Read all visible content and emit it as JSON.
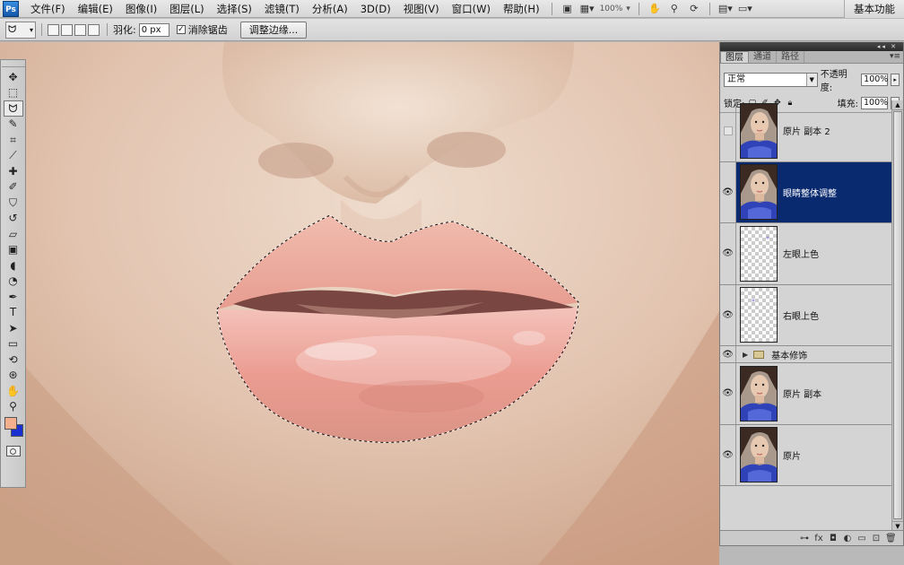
{
  "app": {
    "logo": "Ps"
  },
  "menu": [
    {
      "label": "文件(F)"
    },
    {
      "label": "编辑(E)"
    },
    {
      "label": "图像(I)"
    },
    {
      "label": "图层(L)"
    },
    {
      "label": "选择(S)"
    },
    {
      "label": "滤镜(T)"
    },
    {
      "label": "分析(A)"
    },
    {
      "label": "3D(D)"
    },
    {
      "label": "视图(V)"
    },
    {
      "label": "窗口(W)"
    },
    {
      "label": "帮助(H)"
    }
  ],
  "menubar_tools": {
    "zoom": "100%",
    "workspace": "基本功能"
  },
  "options": {
    "feather_label": "羽化:",
    "feather_value": "0 px",
    "antialias_label": "消除锯齿",
    "antialias_checked": "✓",
    "refine_edge_button": "调整边缘..."
  },
  "toolbox": {
    "tools": [
      {
        "name": "move-tool",
        "glyph": "✥"
      },
      {
        "name": "marquee-tool",
        "glyph": "⬚"
      },
      {
        "name": "lasso-tool",
        "glyph": "ᗢ"
      },
      {
        "name": "quick-select-tool",
        "glyph": "✎"
      },
      {
        "name": "crop-tool",
        "glyph": "⌗"
      },
      {
        "name": "eyedropper-tool",
        "glyph": "⟋"
      },
      {
        "name": "healing-brush-tool",
        "glyph": "✚"
      },
      {
        "name": "brush-tool",
        "glyph": "✐"
      },
      {
        "name": "clone-stamp-tool",
        "glyph": "⛉"
      },
      {
        "name": "history-brush-tool",
        "glyph": "↺"
      },
      {
        "name": "eraser-tool",
        "glyph": "▱"
      },
      {
        "name": "gradient-tool",
        "glyph": "▣"
      },
      {
        "name": "blur-tool",
        "glyph": "◖"
      },
      {
        "name": "dodge-tool",
        "glyph": "◔"
      },
      {
        "name": "pen-tool",
        "glyph": "✒"
      },
      {
        "name": "type-tool",
        "glyph": "T"
      },
      {
        "name": "path-select-tool",
        "glyph": "➤"
      },
      {
        "name": "rectangle-tool",
        "glyph": "▭"
      },
      {
        "name": "3d-rotate-tool",
        "glyph": "⟲"
      },
      {
        "name": "3d-orbit-tool",
        "glyph": "⊛"
      },
      {
        "name": "hand-tool",
        "glyph": "✋"
      },
      {
        "name": "zoom-tool",
        "glyph": "⚲"
      }
    ],
    "active_tool": "lasso-tool",
    "foreground_color": "#f3b08e",
    "background_color": "#1a2fd0"
  },
  "layers_panel": {
    "tabs": [
      "图层",
      "通道",
      "路径"
    ],
    "blend_mode": "正常",
    "opacity_label": "不透明度:",
    "opacity_value": "100%",
    "lock_label": "锁定:",
    "fill_label": "填充:",
    "fill_value": "100%",
    "layers": [
      {
        "name": "原片 副本 2",
        "visible": false,
        "selected": false,
        "thumb": "photo"
      },
      {
        "name": "眼睛整体调整",
        "visible": true,
        "selected": true,
        "thumb": "photo"
      },
      {
        "name": "左眼上色",
        "visible": true,
        "selected": false,
        "thumb": "transparent"
      },
      {
        "name": "右眼上色",
        "visible": true,
        "selected": false,
        "thumb": "transparent"
      },
      {
        "name": "基本修饰",
        "visible": true,
        "selected": false,
        "thumb": "group"
      },
      {
        "name": "原片 副本",
        "visible": true,
        "selected": false,
        "thumb": "photo"
      },
      {
        "name": "原片",
        "visible": true,
        "selected": false,
        "thumb": "photo"
      }
    ]
  },
  "colors": {
    "selected_layer_bg": "#0a2a70",
    "skin_light": "#ecd6c6",
    "lip": "#e79a8e"
  }
}
